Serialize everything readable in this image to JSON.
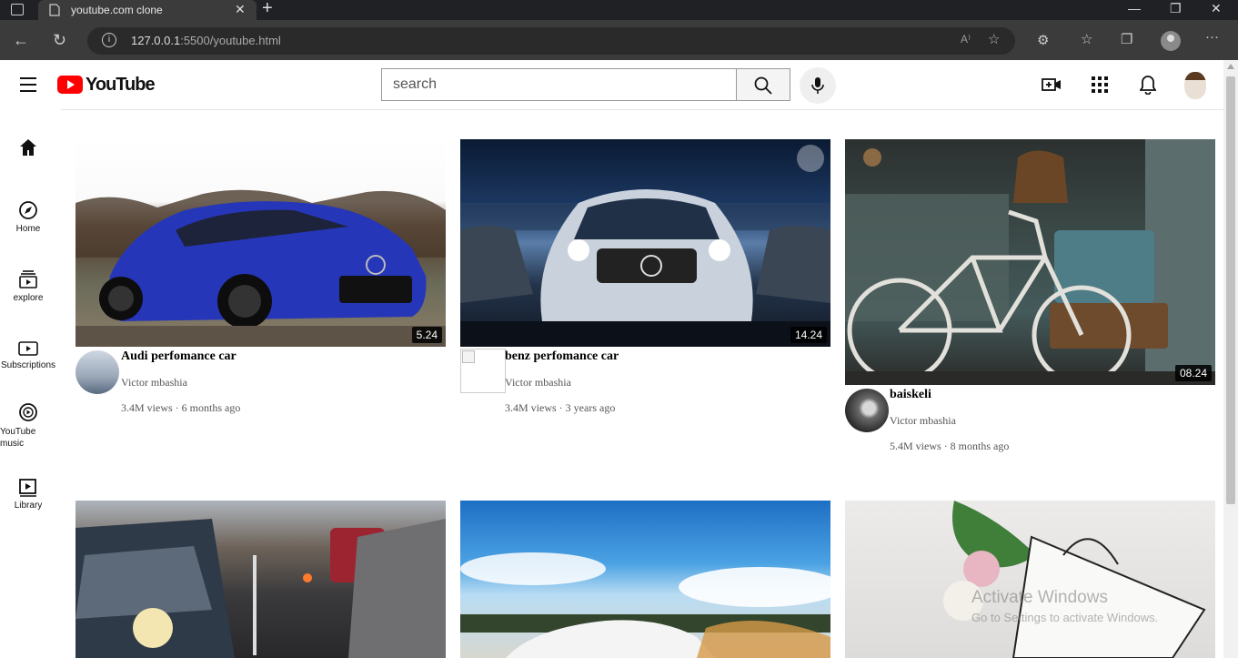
{
  "browser": {
    "tab_title": "youtube.com clone",
    "url_host": "127.0.0.1",
    "url_rest": ":5500/youtube.html",
    "read_aloud_glyph": "A⁾"
  },
  "header": {
    "logo_text": "YouTube",
    "search_placeholder": "search",
    "icons": [
      "menu-icon",
      "search-icon",
      "mic-icon",
      "create-video-icon",
      "apps-icon",
      "bell-icon"
    ]
  },
  "sidebar": {
    "items": [
      {
        "label": "",
        "icon": "home-icon"
      },
      {
        "label": "Home",
        "icon": "compass-icon"
      },
      {
        "label": "explore",
        "icon": "subscriptions-icon"
      },
      {
        "label": "Subscriptions",
        "icon": "play-box-icon"
      },
      {
        "label": "YouTube music",
        "icon": "music-circle-icon"
      },
      {
        "label": "Library",
        "icon": "library-icon"
      }
    ]
  },
  "videos": [
    {
      "title": "Audi perfomance car",
      "channel": "Victor mbashia",
      "views": "3.4M views",
      "age": "6 months ago",
      "duration": "5.24"
    },
    {
      "title": "benz perfomance car",
      "channel": "Victor mbashia",
      "views": "3.4M views",
      "age": "3 years ago",
      "duration": "14.24"
    },
    {
      "title": "baiskeli",
      "channel": "Victor mbashia",
      "views": "5.4M views",
      "age": "8 months ago",
      "duration": "08.24"
    }
  ],
  "meta_separator": "·",
  "watermark": {
    "line1": "Activate Windows",
    "line2": "Go to Settings to activate Windows."
  }
}
